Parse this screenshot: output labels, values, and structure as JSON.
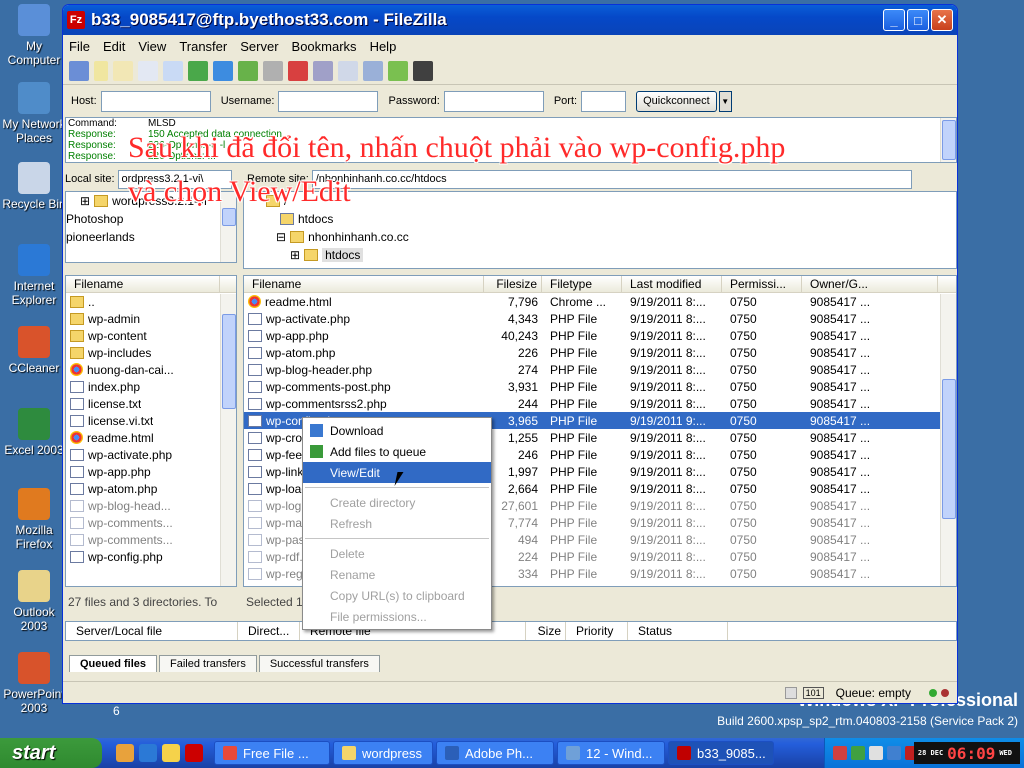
{
  "desktop": {
    "icons": [
      {
        "label": "My Computer",
        "color": "#5a8fd8"
      },
      {
        "label": "My Network Places",
        "color": "#4f8cc9"
      },
      {
        "label": "Recycle Bin",
        "color": "#c9d6e8"
      },
      {
        "label": "Internet Explorer",
        "color": "#2b79d6"
      },
      {
        "label": "CCleaner",
        "color": "#d9532b"
      },
      {
        "label": "Excel 2003",
        "color": "#2e8b3e"
      },
      {
        "label": "Mozilla Firefox",
        "color": "#e07a1f"
      },
      {
        "label": "Outlook 2003",
        "color": "#e8d38a"
      },
      {
        "label": "PowerPoint 2003",
        "color": "#d8532b"
      }
    ],
    "stray_label": "6",
    "os_edition": "Windows XP Professional",
    "build": "Build 2600.xpsp_sp2_rtm.040803-2158 (Service Pack 2)"
  },
  "window": {
    "title": "b33_9085417@ftp.byethost33.com - FileZilla",
    "app_icon": "Fz",
    "min": "_",
    "max": "□",
    "close": "✕"
  },
  "menu": [
    "File",
    "Edit",
    "View",
    "Transfer",
    "Server",
    "Bookmarks",
    "Help"
  ],
  "quickconnect": {
    "host_label": "Host:",
    "user_label": "Username:",
    "pass_label": "Password:",
    "port_label": "Port:",
    "button": "Quickconnect",
    "host_value": "",
    "user_value": "",
    "pass_value": "",
    "port_value": ""
  },
  "log": [
    {
      "label": "Command:",
      "text": "MLSD",
      "kind": "cmd"
    },
    {
      "label": "Response:",
      "text": "150 Accepted data connection",
      "kind": "resp"
    },
    {
      "label": "Response:",
      "text": "226-Options: -a -l",
      "kind": "resp"
    },
    {
      "label": "Response:",
      "text": "226 Options: ...",
      "kind": "resp"
    }
  ],
  "caption": {
    "line1": "Sau khi đã đổi tên, nhấn chuột phải vào wp-config.php",
    "line2": "và chọn View/Edit"
  },
  "local": {
    "site_label": "Local site:",
    "site_value": "ordpress3.2.1-vi\\",
    "tree": [
      {
        "label": "wordpress3.2.1-vi",
        "indent": 1
      },
      {
        "label": "Photoshop",
        "indent": 0
      },
      {
        "label": "pioneerlands",
        "indent": 0
      }
    ],
    "columns": [
      "Filename"
    ],
    "files": [
      {
        "name": "..",
        "icon": "folder"
      },
      {
        "name": "wp-admin",
        "icon": "folder"
      },
      {
        "name": "wp-content",
        "icon": "folder"
      },
      {
        "name": "wp-includes",
        "icon": "folder"
      },
      {
        "name": "huong-dan-cai...",
        "icon": "chrome"
      },
      {
        "name": "index.php",
        "icon": "file"
      },
      {
        "name": "license.txt",
        "icon": "file"
      },
      {
        "name": "license.vi.txt",
        "icon": "file"
      },
      {
        "name": "readme.html",
        "icon": "chrome"
      },
      {
        "name": "wp-activate.php",
        "icon": "file"
      },
      {
        "name": "wp-app.php",
        "icon": "file"
      },
      {
        "name": "wp-atom.php",
        "icon": "file"
      },
      {
        "name": "wp-blog-head...",
        "icon": "file"
      },
      {
        "name": "wp-comments...",
        "icon": "file"
      },
      {
        "name": "wp-comments...",
        "icon": "file"
      },
      {
        "name": "wp-config.php",
        "icon": "file"
      }
    ],
    "status": "27 files and 3 directories. To"
  },
  "remote": {
    "site_label": "Remote site:",
    "site_value": "/nhonhinhanh.co.cc/htdocs",
    "tree": [
      {
        "label": "/",
        "indent": 1,
        "icon": "folder"
      },
      {
        "label": "htdocs",
        "indent": 2,
        "icon": "question"
      },
      {
        "label": "nhonhinhanh.co.cc",
        "indent": 2,
        "icon": "folder"
      },
      {
        "label": "htdocs",
        "indent": 3,
        "icon": "folder"
      }
    ],
    "columns": [
      "Filename",
      "Filesize",
      "Filetype",
      "Last modified",
      "Permissi...",
      "Owner/G..."
    ],
    "files": [
      {
        "name": "readme.html",
        "size": "7,796",
        "type": "Chrome ...",
        "modified": "9/19/2011 8:...",
        "perm": "0750",
        "owner": "9085417 ...",
        "icon": "chrome"
      },
      {
        "name": "wp-activate.php",
        "size": "4,343",
        "type": "PHP File",
        "modified": "9/19/2011 8:...",
        "perm": "0750",
        "owner": "9085417 ...",
        "icon": "file"
      },
      {
        "name": "wp-app.php",
        "size": "40,243",
        "type": "PHP File",
        "modified": "9/19/2011 8:...",
        "perm": "0750",
        "owner": "9085417 ...",
        "icon": "file"
      },
      {
        "name": "wp-atom.php",
        "size": "226",
        "type": "PHP File",
        "modified": "9/19/2011 8:...",
        "perm": "0750",
        "owner": "9085417 ...",
        "icon": "file"
      },
      {
        "name": "wp-blog-header.php",
        "size": "274",
        "type": "PHP File",
        "modified": "9/19/2011 8:...",
        "perm": "0750",
        "owner": "9085417 ...",
        "icon": "file"
      },
      {
        "name": "wp-comments-post.php",
        "size": "3,931",
        "type": "PHP File",
        "modified": "9/19/2011 8:...",
        "perm": "0750",
        "owner": "9085417 ...",
        "icon": "file"
      },
      {
        "name": "wp-commentsrss2.php",
        "size": "244",
        "type": "PHP File",
        "modified": "9/19/2011 8:...",
        "perm": "0750",
        "owner": "9085417 ...",
        "icon": "file"
      },
      {
        "name": "wp-config.php",
        "size": "3,965",
        "type": "PHP File",
        "modified": "9/19/2011 9:...",
        "perm": "0750",
        "owner": "9085417 ...",
        "icon": "file",
        "selected": true
      },
      {
        "name": "wp-cron.php",
        "size": "1,255",
        "type": "PHP File",
        "modified": "9/19/2011 8:...",
        "perm": "0750",
        "owner": "9085417 ...",
        "icon": "file"
      },
      {
        "name": "wp-feed.php",
        "size": "246",
        "type": "PHP File",
        "modified": "9/19/2011 8:...",
        "perm": "0750",
        "owner": "9085417 ...",
        "icon": "file"
      },
      {
        "name": "wp-links-opml.php",
        "size": "1,997",
        "type": "PHP File",
        "modified": "9/19/2011 8:...",
        "perm": "0750",
        "owner": "9085417 ...",
        "icon": "file"
      },
      {
        "name": "wp-load.php",
        "size": "2,664",
        "type": "PHP File",
        "modified": "9/19/2011 8:...",
        "perm": "0750",
        "owner": "9085417 ...",
        "icon": "file"
      },
      {
        "name": "wp-login.php",
        "size": "27,601",
        "type": "PHP File",
        "modified": "9/19/2011 8:...",
        "perm": "0750",
        "owner": "9085417 ...",
        "icon": "file",
        "dim": true
      },
      {
        "name": "wp-mail.php",
        "size": "7,774",
        "type": "PHP File",
        "modified": "9/19/2011 8:...",
        "perm": "0750",
        "owner": "9085417 ...",
        "icon": "file",
        "dim": true
      },
      {
        "name": "wp-pass.php",
        "size": "494",
        "type": "PHP File",
        "modified": "9/19/2011 8:...",
        "perm": "0750",
        "owner": "9085417 ...",
        "icon": "file",
        "dim": true
      },
      {
        "name": "wp-rdf.php",
        "size": "224",
        "type": "PHP File",
        "modified": "9/19/2011 8:...",
        "perm": "0750",
        "owner": "9085417 ...",
        "icon": "file",
        "dim": true
      },
      {
        "name": "wp-register.php",
        "size": "334",
        "type": "PHP File",
        "modified": "9/19/2011 8:...",
        "perm": "0750",
        "owner": "9085417 ...",
        "icon": "file",
        "dim": true
      }
    ],
    "status": "Selected 1"
  },
  "context_menu": [
    {
      "label": "Download",
      "icon": "download-icon",
      "state": "normal"
    },
    {
      "label": "Add files to queue",
      "icon": "queue-add-icon",
      "state": "normal"
    },
    {
      "label": "View/Edit",
      "icon": "",
      "state": "highlight"
    },
    {
      "sep": true
    },
    {
      "label": "Create directory",
      "state": "disabled"
    },
    {
      "label": "Refresh",
      "state": "disabled"
    },
    {
      "sep": true
    },
    {
      "label": "Delete",
      "state": "disabled"
    },
    {
      "label": "Rename",
      "state": "disabled"
    },
    {
      "label": "Copy URL(s) to clipboard",
      "state": "disabled"
    },
    {
      "label": "File permissions...",
      "state": "disabled"
    }
  ],
  "queue": {
    "columns": [
      "Server/Local file",
      "Direct...",
      "Remote file",
      "Size",
      "Priority",
      "Status"
    ],
    "tabs": [
      "Queued files",
      "Failed transfers",
      "Successful transfers"
    ]
  },
  "statusbar": {
    "queue": "Queue: empty"
  },
  "taskbar": {
    "start": "start",
    "tasks": [
      {
        "label": "Free File ...",
        "color": "#e84a3a"
      },
      {
        "label": "wordpress",
        "color": "#f5d56a"
      },
      {
        "label": "Adobe Ph...",
        "color": "#2b5fb8"
      },
      {
        "label": "12 - Wind...",
        "color": "#6fa0d8"
      },
      {
        "label": "b33_9085...",
        "color": "#c00000",
        "active": true
      }
    ],
    "clock": "06:09",
    "day": "28 DEC",
    "weekday": "WED"
  }
}
